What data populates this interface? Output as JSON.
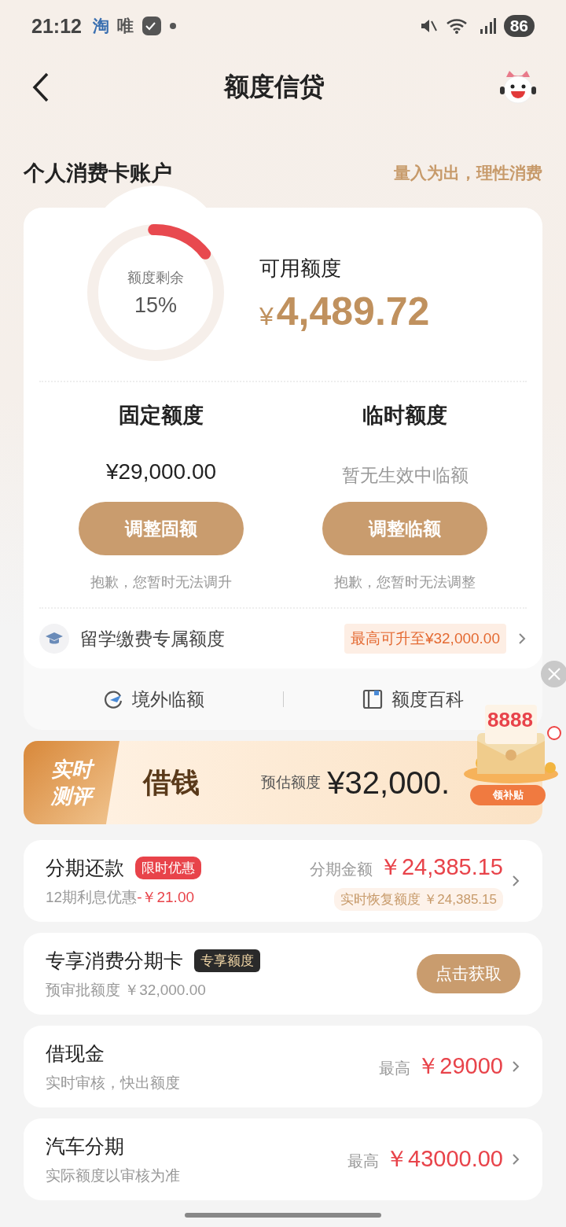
{
  "status_bar": {
    "time": "21:12",
    "apps": [
      "淘",
      "唯"
    ],
    "battery": "86"
  },
  "header": {
    "title": "额度信贷"
  },
  "account": {
    "title": "个人消费卡账户",
    "slogan": "量入为出，理性消费"
  },
  "gauge": {
    "label": "额度剩余",
    "percent": "15%",
    "level": 0.15
  },
  "available": {
    "label": "可用额度",
    "currency": "¥",
    "amount": "4,489.72"
  },
  "quotas": [
    {
      "title": "固定额度",
      "kind": "amount",
      "value": "¥29,000.00",
      "button": "调整固额",
      "note": "抱歉，您暂时无法调升"
    },
    {
      "title": "临时额度",
      "kind": "empty",
      "value": "暂无生效中临额",
      "button": "调整临额",
      "note": "抱歉，您暂时无法调整"
    }
  ],
  "study": {
    "label": "留学缴费专属额度",
    "badge": "最高可升至¥32,000.00"
  },
  "shortcuts": [
    {
      "label": "境外临额",
      "kind": "overseas"
    },
    {
      "label": "额度百科",
      "kind": "wiki"
    }
  ],
  "banner": {
    "tag": [
      "实时",
      "测评"
    ],
    "title": "借钱",
    "label": "预估额度",
    "amount": "¥32,000."
  },
  "promo": {
    "amount": "8888",
    "button": "领补贴"
  },
  "products": [
    {
      "kind": "installment",
      "title": "分期还款",
      "badge": "限时优惠",
      "sub": "12期利息优惠",
      "sub_value": "-￥21.00",
      "amount_label": "分期金额",
      "amount": "￥24,385.15",
      "extra": "实时恢复额度 ￥24,385.15"
    },
    {
      "kind": "card",
      "title": "专享消费分期卡",
      "badge": "专享额度",
      "sub": "预审批额度 ￥32,000.00",
      "button": "点击获取"
    },
    {
      "kind": "max",
      "title": "借现金",
      "sub": "实时审核，快出额度",
      "amount_label": "最高",
      "amount": "￥29000"
    },
    {
      "kind": "max",
      "title": "汽车分期",
      "sub": "实际额度以审核为准",
      "amount_label": "最高",
      "amount": "￥43000.00"
    }
  ]
}
